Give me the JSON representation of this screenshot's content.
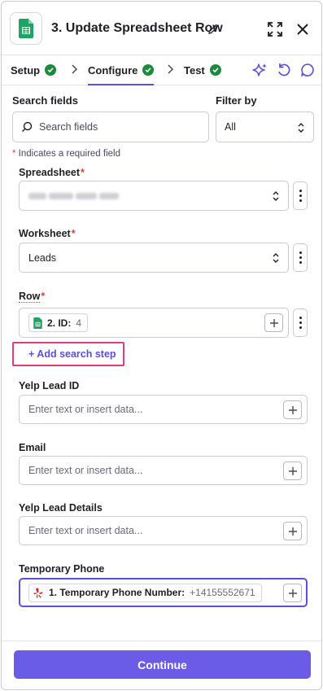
{
  "header": {
    "title": "3. Update Spreadsheet Row"
  },
  "tabs": [
    {
      "label": "Setup"
    },
    {
      "label": "Configure"
    },
    {
      "label": "Test"
    }
  ],
  "search": {
    "label": "Search fields",
    "placeholder": "Search fields"
  },
  "filter": {
    "label": "Filter by",
    "value": "All"
  },
  "required_note": {
    "star": "*",
    "text": " Indicates a required field"
  },
  "fields": {
    "spreadsheet": {
      "label": "Spreadsheet",
      "required": "*"
    },
    "worksheet": {
      "label": "Worksheet",
      "required": "*",
      "value": "Leads"
    },
    "row": {
      "label": "Row",
      "required": "*",
      "pill_label": "2. ID:",
      "pill_value": "4"
    },
    "add_search_step": "+ Add search step",
    "yelp_lead_id": {
      "label": "Yelp Lead ID",
      "placeholder": "Enter text or insert data..."
    },
    "email": {
      "label": "Email",
      "placeholder": "Enter text or insert data..."
    },
    "yelp_lead_details": {
      "label": "Yelp Lead Details",
      "placeholder": "Enter text or insert data..."
    },
    "temporary_phone": {
      "label": "Temporary Phone",
      "pill_label": "1. Temporary Phone Number:",
      "pill_value": "+14155552671"
    }
  },
  "footer": {
    "continue_label": "Continue"
  },
  "colors": {
    "accent": "#6b5ce7",
    "success": "#1b8a3b",
    "required": "#d9433d",
    "highlight": "#e23a7a",
    "sheets_green": "#1ea362"
  }
}
